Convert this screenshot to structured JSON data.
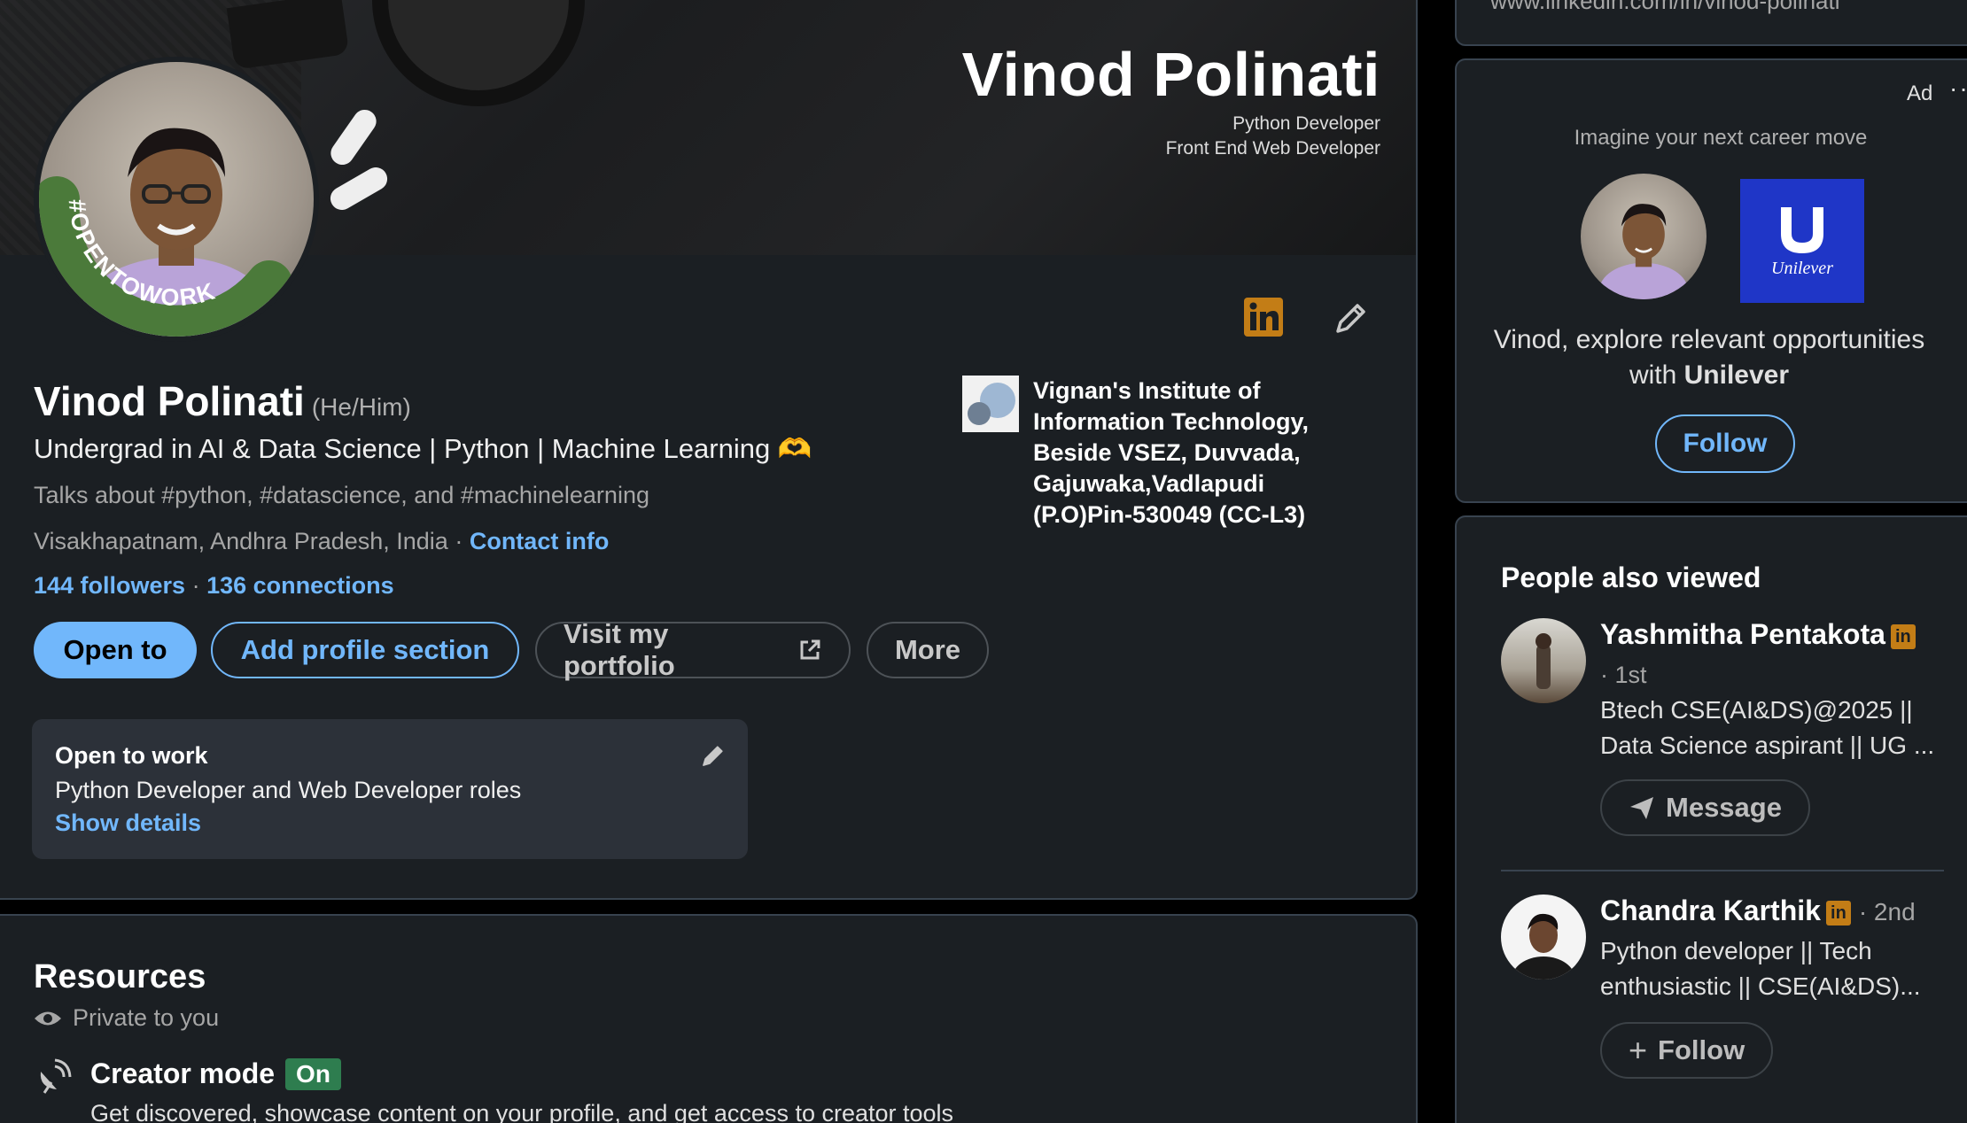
{
  "banner": {
    "name": "Vinod Polinati",
    "line1": "Python Developer",
    "line2": "Front End Web Developer"
  },
  "avatar": {
    "frame_text": "#OPENTOWORK",
    "frame_color": "#4b7a3a"
  },
  "profile": {
    "name": "Vinod Polinati",
    "pronouns": "(He/Him)",
    "headline": "Undergrad in AI & Data Science | Python | Machine Learning 🫶",
    "talks_about": "Talks about #python, #datascience, and #machinelearning",
    "location": "Visakhapatnam, Andhra Pradesh, India",
    "location_sep": " · ",
    "contact_info": "Contact info",
    "followers": "144 followers",
    "stats_sep": " · ",
    "connections": "136 connections"
  },
  "actions": {
    "open_to": "Open to",
    "add_section": "Add profile section",
    "portfolio": "Visit my portfolio",
    "more": "More"
  },
  "school": {
    "name": "Vignan's Institute of Information Technology, Beside VSEZ, Duvvada, Gajuwaka,Vadlapudi (P.O)Pin-530049 (CC-L3)"
  },
  "open_to_work": {
    "title": "Open to work",
    "roles": "Python Developer and Web Developer roles",
    "show_details": "Show details"
  },
  "resources": {
    "title": "Resources",
    "private": "Private to you",
    "creator_mode": "Creator mode",
    "creator_status": "On",
    "creator_desc": "Get discovered, showcase content on your profile, and get access to creator tools"
  },
  "sidebar": {
    "url": "www.linkedin.com/in/vinod-polinati",
    "ad": {
      "label": "Ad",
      "dots": "···",
      "tagline": "Imagine your next career move",
      "brand": "Unilever",
      "message_prefix": "Vinod, explore relevant opportunities with ",
      "message_brand": "Unilever",
      "follow": "Follow"
    },
    "people_also_viewed": {
      "title": "People also viewed",
      "people": [
        {
          "name": "Yashmitha Pentakota",
          "degree": "· 1st",
          "headline": "Btech CSE(AI&DS)@2025 || Data Science aspirant || UG ...",
          "action": "Message"
        },
        {
          "name": "Chandra Karthik",
          "degree": "· 2nd",
          "headline": "Python developer || Tech enthusiastic || CSE(AI&DS)...",
          "action": "Follow"
        }
      ]
    }
  },
  "colors": {
    "accent": "#71b7fb",
    "card_bg": "#1b1f23",
    "linkedin_gold": "#c37d16",
    "unilever_blue": "#1f36c7"
  }
}
